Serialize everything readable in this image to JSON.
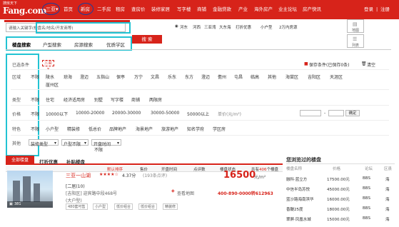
{
  "logo": {
    "top": "搜房天下",
    "main": "Fang.com"
  },
  "header": {
    "city": "三亚",
    "nav": [
      "首页",
      "新房",
      "二手房",
      "租房",
      "查房价",
      "装修家居",
      "写字楼",
      "商铺",
      "金融贷款",
      "产业",
      "海外房产",
      "业主论坛",
      "房产快讯"
    ],
    "login": "登录",
    "register": "注册",
    "divider": "|"
  },
  "search": {
    "placeholder": "请输入关键字(楼盘名/地名/开发商等)",
    "button": "搜 索",
    "hot_links": [
      "河东",
      "河西",
      "三亚湾",
      "大东海",
      "打折优惠",
      "小户型",
      "2万内房源"
    ],
    "map_label": "地图",
    "list_label": "列表"
  },
  "tabs": [
    "楼盘搜索",
    "户型搜索",
    "房源搜索",
    "优质学区"
  ],
  "filters": {
    "selected_label": "已选条件",
    "selected_tag": "三亚 ×",
    "save_label": "保存条件(已保存0条)",
    "clear_label": "清空",
    "region_label": "区域",
    "region_opts": [
      "不限",
      "陵水",
      "琼海",
      "澄迈",
      "五指山",
      "保亭",
      "万宁",
      "文昌",
      "乐东",
      "东方",
      "澄迈",
      "儋州",
      "屯昌",
      "临高",
      "其他",
      "海棠区",
      "吉阳区",
      "天涯区"
    ],
    "region_row2": "崖州区",
    "type_label": "类型",
    "type_opts": [
      "不限",
      "住宅",
      "经济适用房",
      "别墅",
      "写字楼",
      "商铺",
      "两限房"
    ],
    "price_label": "价格",
    "price_opts": [
      "不限",
      "10000以下",
      "10000-20000",
      "20000-30000",
      "30000-50000",
      "50000以上"
    ],
    "price_unit": "单价(元/m²)",
    "price_dash": "-",
    "confirm": "确定",
    "feature_label": "特色",
    "feature_opts": [
      "不限",
      "小户型",
      "精装修",
      "低总价",
      "品牌地产",
      "海景地产",
      "旅游地产",
      "知名学府",
      "学区房"
    ],
    "other_label": "其他",
    "other_opts": [
      "装修类型",
      "户型不限",
      "开盘时间"
    ],
    "other_sub": "不限"
  },
  "result_tabs": [
    "全部楼盘",
    "打折优惠",
    "补贴楼盘"
  ],
  "sort": {
    "items": [
      "默认排序",
      "售价",
      "开盘时间",
      "点评数",
      "楼盘状态"
    ],
    "count_prefix": "共有",
    "count": "406",
    "count_suffix": "个楼盘"
  },
  "listing": {
    "name": "三亚一山湖",
    "score": "4.37分",
    "reviews": "(193条点评)",
    "sub1": "[二居(10)",
    "sub2": "[吉阳区] 迎宾路中段468号",
    "sub3": "(大户型)",
    "map_link": "查看地图",
    "price": "16500",
    "price_unit": "元/m²",
    "phone": "400-890-0000转612963",
    "tags": [
      "480套可售",
      "小户型",
      "低价组合",
      "低价组合",
      "精装修"
    ],
    "img_count": "381"
  },
  "rank": {
    "title": "您浏览过的楼盘",
    "headers": [
      "楼盘名称",
      "价格",
      "论坛",
      "区县"
    ],
    "rows": [
      [
        "融科·蓝立方",
        "17500.00元",
        "BBS",
        "海"
      ],
      [
        "中信半岛苏悦",
        "45000.00元",
        "BBS",
        "海"
      ],
      [
        "蓝沙路海南滨华",
        "16000.00元",
        "BBS",
        "海"
      ],
      [
        "香醍25度",
        "18000.00元",
        "BBS",
        "海"
      ],
      [
        "翠屏·凤凰水城",
        "15000.00元",
        "BBS",
        "海"
      ]
    ]
  }
}
